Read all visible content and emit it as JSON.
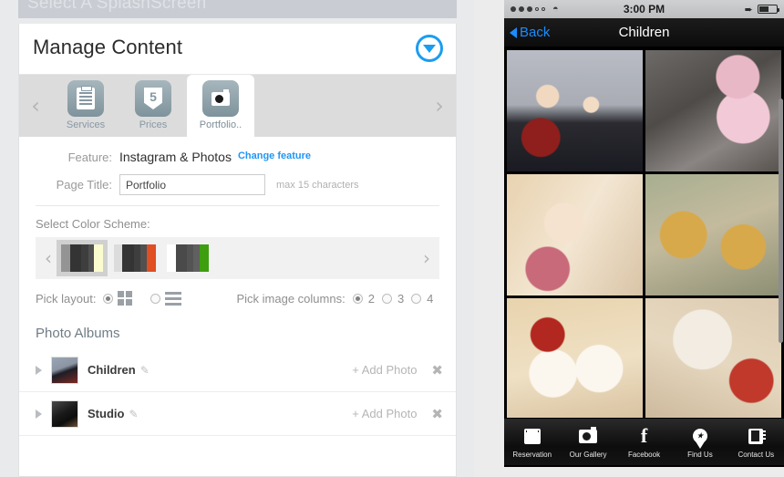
{
  "left_panel": {
    "splash_bar_title": "Select A SplashScreen",
    "manage_title": "Manage Content",
    "dropdown_icon": "chevron-down-circle-icon",
    "prev_arrow": "‹",
    "next_arrow": "›",
    "feature_tabs": [
      {
        "label": "Services",
        "icon": "clipboard-icon",
        "active": false
      },
      {
        "label": "Prices",
        "icon": "html5-icon",
        "active": false
      },
      {
        "label": "Portfolio..",
        "icon": "camera-icon",
        "active": true
      }
    ],
    "form": {
      "feature_label": "Feature:",
      "feature_value": "Instagram & Photos",
      "change_feature_link": "Change feature",
      "page_title_label": "Page Title:",
      "page_title_value": "Portfolio",
      "page_title_placeholder": "Portfolio",
      "page_title_hint": "max 15 characters"
    },
    "color_scheme": {
      "label": "Select Color Scheme:",
      "prev_arrow": "‹",
      "next_arrow": "›",
      "selected_index": 0,
      "swatches": [
        {
          "bands": [
            "#949494",
            "#343434",
            "#3e3e3e",
            "#505050",
            "#fbfbd0"
          ]
        },
        {
          "bands": [
            "#dcdcdc",
            "#343434",
            "#3e3e3e",
            "#505050",
            "#e04e24"
          ]
        },
        {
          "bands": [
            "#ffffff",
            "#4a4a4a",
            "#545454",
            "#606060",
            "#3e9e10"
          ]
        }
      ]
    },
    "layout": {
      "pick_layout_label": "Pick layout:",
      "grid_option_selected": true,
      "list_option_selected": false,
      "grid_icon": "grid-layout-icon",
      "list_icon": "list-layout-icon",
      "pick_columns_label": "Pick image columns:",
      "column_options": [
        "2",
        "3",
        "4"
      ],
      "selected_columns": "2"
    },
    "albums": {
      "title": "Photo Albums",
      "add_photo_label": "+ Add Photo",
      "remove_label": "✖",
      "edit_icon": "pencil-icon",
      "rows": [
        {
          "name": "Children",
          "thumb_colors": [
            "#9aa6b4",
            "#1d1d26",
            "#7b2b24"
          ]
        },
        {
          "name": "Studio",
          "thumb_colors": [
            "#3a3a3a",
            "#111111",
            "#6b5236"
          ]
        }
      ]
    }
  },
  "phone": {
    "status": {
      "signal_filled": 3,
      "signal_empty": 2,
      "wifi_icon": "wifi-icon",
      "time": "3:00 PM",
      "location_icon": "location-arrow-icon",
      "battery_icon": "battery-icon",
      "battery_percent": 55
    },
    "nav": {
      "back_label": "Back",
      "back_icon": "chevron-left-icon",
      "title": "Children"
    },
    "gallery": {
      "scrollbar": "vertical-scrollbar",
      "photos": [
        {
          "alt": "two-girls-black-dresses-red-flowers",
          "c1": "#b9bcc4",
          "c2": "#1a1a22",
          "c3": "#8e1f1c"
        },
        {
          "alt": "girl-pink-tutu-with-chair",
          "c1": "#5d5a58",
          "c2": "#e9b8c6",
          "c3": "#2b2520"
        },
        {
          "alt": "girl-with-teddy-bear-wicker-chair",
          "c1": "#e3c9a4",
          "c2": "#f0dcc8",
          "c3": "#c86a7a"
        },
        {
          "alt": "kids-with-gold-picture-frames",
          "c1": "#9aa487",
          "c2": "#d8a94a",
          "c3": "#efe2cd"
        },
        {
          "alt": "babies-in-santa-hats-christmas-lights",
          "c1": "#e6cfa8",
          "c2": "#fbf6ee",
          "c3": "#b2271f"
        },
        {
          "alt": "baby-with-husky-dog-on-rug",
          "c1": "#d9c7ae",
          "c2": "#f2ece2",
          "c3": "#c0392b"
        }
      ]
    },
    "tab_bar": [
      {
        "label": "Reservation",
        "icon": "calendar-icon"
      },
      {
        "label": "Our Gallery",
        "icon": "camera-icon"
      },
      {
        "label": "Facebook",
        "icon": "facebook-icon",
        "glyph": "f"
      },
      {
        "label": "Find Us",
        "icon": "map-pin-icon",
        "glyph": "★"
      },
      {
        "label": "Contact Us",
        "icon": "contact-card-icon"
      }
    ]
  }
}
